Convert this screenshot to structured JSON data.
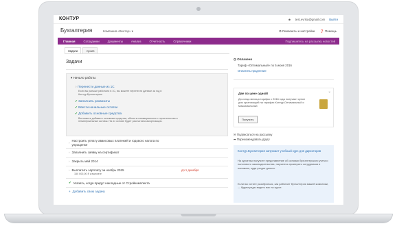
{
  "topbar": {
    "logo": "КОНТУР",
    "email": "test.evrika@gmail.com",
    "logout": "Выйти"
  },
  "header": {
    "title": "Бухгалтерия",
    "company": "Компания «Вектор» ▾",
    "help": "Помощь",
    "settings": "Реквизиты и настройки"
  },
  "nav": {
    "items": [
      "Главная",
      "Сотрудники",
      "Документы",
      "Анализ",
      "Отчетность",
      "Справочники"
    ],
    "right": "Подпишитесь на рассылку новостей"
  },
  "subtabs": [
    "Задачи",
    "Архив"
  ],
  "main": {
    "heading": "Задачи",
    "panel_title": "Начало работы",
    "panel_items": [
      {
        "label": "Перенести данные из 1С",
        "type": "link"
      },
      {
        "label": "Если вы раньше работали в 1С, вы можете перенести данные за год в Контур.Бухгалтерию",
        "type": "note"
      },
      {
        "label": "Заполнить реквизиты",
        "type": "done"
      },
      {
        "label": "Ввести начальные остатки",
        "type": "done"
      },
      {
        "label": "Добавить основные средства",
        "type": "done"
      },
      {
        "label": "Вы можете добавить основные средства, объекты незавершенного строительства и нематериальные активы. На их основе будет рассчитана амортизация.",
        "type": "note"
      }
    ],
    "tasks": [
      {
        "label": "Настроить уплату авансовых платежей и годового налога по упрощенке",
        "due": ""
      },
      {
        "label": "Заполнить заявку на сертификат",
        "due": ""
      },
      {
        "label": "Закрыть май 2014",
        "due": ""
      },
      {
        "label": "Выплатить зарплату за ноябрь 2015",
        "sub": "150 000,00 ₽ к выплате",
        "due": "до 1 декабря"
      },
      {
        "label": "Указать, когда придут накладные от Стройкомплекта",
        "due": ""
      }
    ],
    "add_task": "Добавить свою задачу"
  },
  "sidebar": {
    "plan_title": "Оплачено",
    "plan_text": "Тариф «Оптимальный» по 5 июня 2016",
    "plan_link": "Оплатить продление",
    "promo_title": "Две по цене одной!",
    "promo_text": "До конца месяца тарифы с 2016 года получают купон для организаций на тарифах Контур.Оптимальный и Максимальный",
    "promo_button": "Получить",
    "subscribe": "Подписаться на рассылку",
    "recommend": "Порекомендовать другу",
    "course_title": "Контур.Бухгалтерия запускает учебный курс для директоров",
    "course_text1": "На курсе вы получите представление об основах бухгалтерского учета и налогового законодательства, научитесь проверять сотрудников и понимать, куда уходят деньги.",
    "course_text2": "Если вы хотите разобраться, как работает бухгалтерия вашей компании, — будем рады видеть вас на курсе."
  }
}
